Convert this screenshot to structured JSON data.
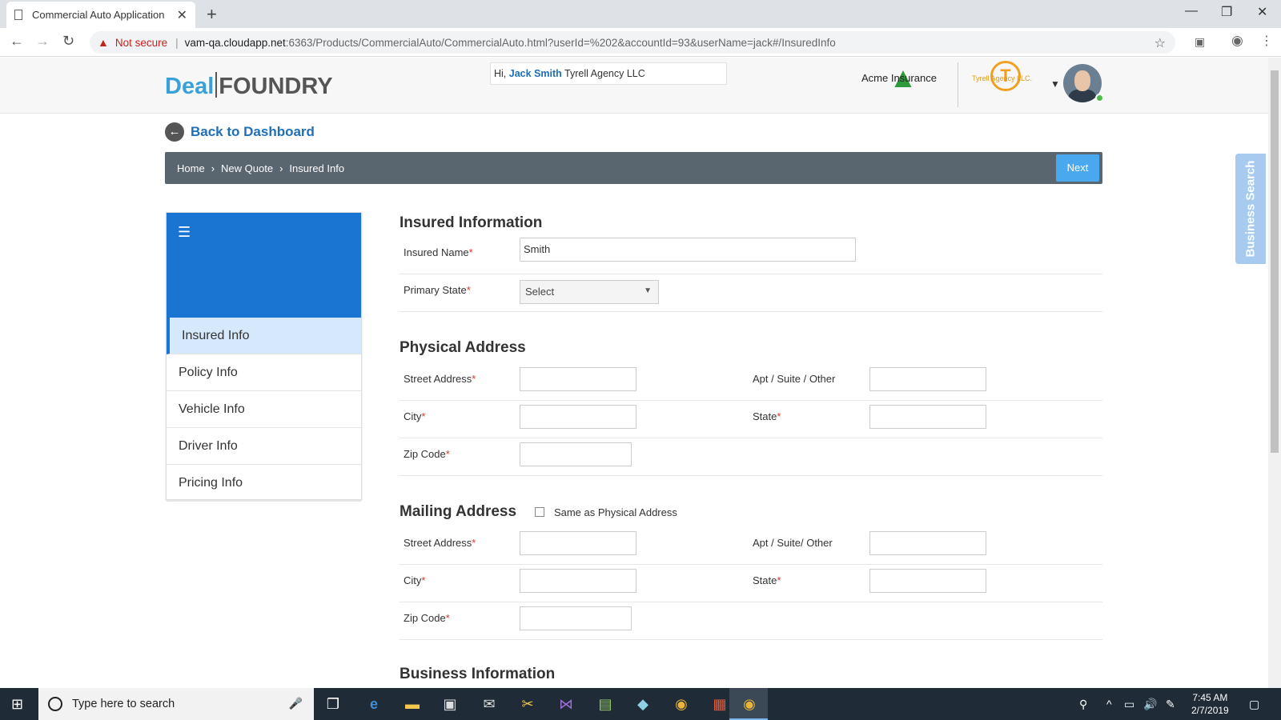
{
  "browser": {
    "tab_title": "Commercial Auto Application",
    "not_secure": "Not secure",
    "url_host": "vam-qa.cloudapp.net",
    "url_path": ":6363/Products/CommercialAuto/CommercialAuto.html?userId=%202&accountId=93&userName=jack#/InsuredInfo"
  },
  "header": {
    "logo_deal": "Deal",
    "logo_foundry": "FOUNDRY",
    "greeting_prefix": "Hi,",
    "user_name": "Jack Smith",
    "agency_name": "Tyrell Agency LLC",
    "carrier_label": "Acme Insurance",
    "agency_logo_letter": "T",
    "agency_logo_label": "Tyrell Agency LLC."
  },
  "back_link": "Back to Dashboard",
  "breadcrumb": {
    "items": [
      "Home",
      "New Quote",
      "Insured Info"
    ],
    "next_label": "Next"
  },
  "sidenav": {
    "items": [
      "Insured Info",
      "Policy Info",
      "Vehicle Info",
      "Driver Info",
      "Pricing Info"
    ],
    "active": "Insured Info"
  },
  "insured": {
    "title": "Insured Information",
    "name_label": "Insured Name",
    "name_value": "Smith",
    "state_label": "Primary State",
    "state_value": "Select"
  },
  "physical": {
    "title": "Physical Address",
    "street_label": "Street Address",
    "apt_label": "Apt / Suite / Other",
    "city_label": "City",
    "state_label": "State",
    "zip_label": "Zip Code"
  },
  "mailing": {
    "title": "Mailing Address",
    "same_label": "Same as Physical Address",
    "street_label": "Street Address",
    "apt_label": "Apt / Suite/ Other",
    "city_label": "City",
    "state_label": "State",
    "zip_label": "Zip Code"
  },
  "business": {
    "title": "Business Information"
  },
  "side_tab": "Business Search",
  "taskbar": {
    "search_placeholder": "Type here to search",
    "time": "7:45 AM",
    "date": "2/7/2019"
  },
  "colors": {
    "primary": "#1a75d2",
    "breadcrumb_bg": "#59656f",
    "next_button": "#4aa8ef",
    "required": "#d9342b"
  }
}
